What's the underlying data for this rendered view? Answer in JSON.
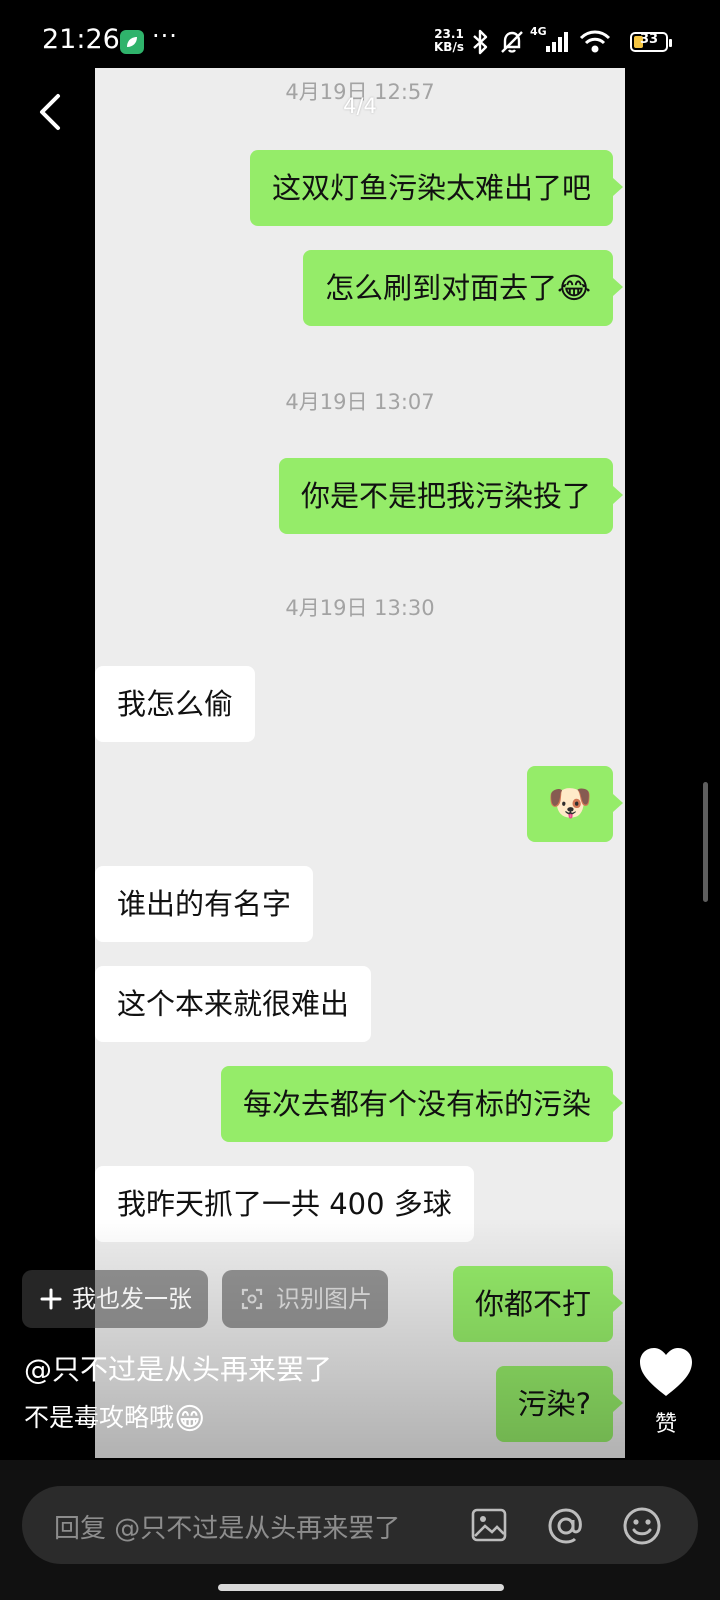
{
  "status_bar": {
    "time": "21:26",
    "more": "···",
    "net_speed_value": "23.1",
    "net_speed_unit": "KB/s",
    "signal_label": "4G",
    "battery_level": "33"
  },
  "viewer": {
    "page_indicator": "4/4"
  },
  "chat": {
    "timestamps": [
      "4月19日 12:57",
      "4月19日 13:07",
      "4月19日 13:30"
    ],
    "messages": [
      {
        "side": "out",
        "text": "这双灯鱼污染太难出了吧"
      },
      {
        "side": "out",
        "text": "怎么刷到对面去了",
        "emoji": "😂"
      },
      {
        "side": "out",
        "text": "你是不是把我污染投了"
      },
      {
        "side": "in",
        "text": "我怎么偷"
      },
      {
        "side": "out",
        "text": "",
        "emoji": "🐶"
      },
      {
        "side": "in",
        "text": "谁出的有名字"
      },
      {
        "side": "in",
        "text": "这个本来就很难出"
      },
      {
        "side": "out",
        "text": "每次去都有个没有标的污染"
      },
      {
        "side": "in",
        "text": "我昨天抓了一共 400 多球"
      },
      {
        "side": "out",
        "text": "你都不打"
      },
      {
        "side": "out",
        "text": "污染?"
      }
    ]
  },
  "actions": {
    "post_too_label": "我也发一张",
    "recognize_label": "识别图片"
  },
  "post": {
    "mention": "@只不过是从头再来罢了",
    "caption": "不是毒攻略哦",
    "caption_emoji": "😁",
    "like_label": "赞"
  },
  "reply_bar": {
    "placeholder": "回复 @只不过是从头再来罢了"
  },
  "icons": {
    "back": "chevron-left-icon",
    "image": "image-icon",
    "mention": "at-icon",
    "emoji": "smiley-icon",
    "like": "heart-icon",
    "plus": "plus-icon",
    "scan": "scan-icon"
  },
  "colors": {
    "outgoing_bubble": "#95ec69",
    "incoming_bubble": "#ffffff",
    "chat_background": "#ededed"
  }
}
